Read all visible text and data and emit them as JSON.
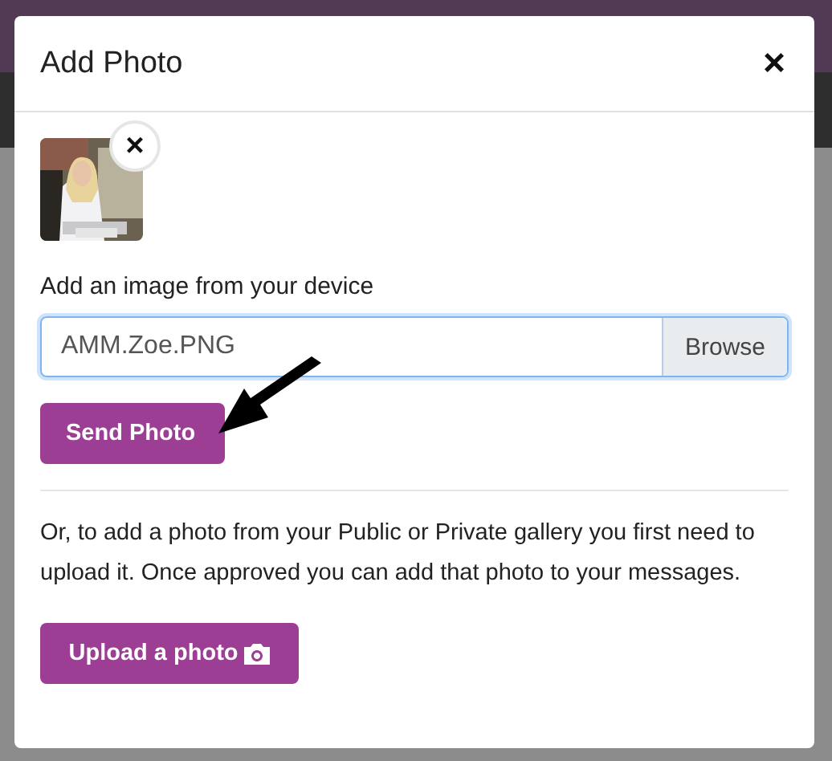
{
  "dialog": {
    "title": "Add Photo",
    "close": "×"
  },
  "attachment": {
    "kind": "picture",
    "remove": "×"
  },
  "device_upload": {
    "label": "Add an image from your device",
    "value": "AMM.Zoe.PNG",
    "browse": "Browse",
    "send": "Send Photo"
  },
  "gallery": {
    "text": "Or, to add a photo from your Public or Private gallery you first need to upload it. Once approved you can add that photo to your messages.",
    "upload": "Upload a photo"
  }
}
